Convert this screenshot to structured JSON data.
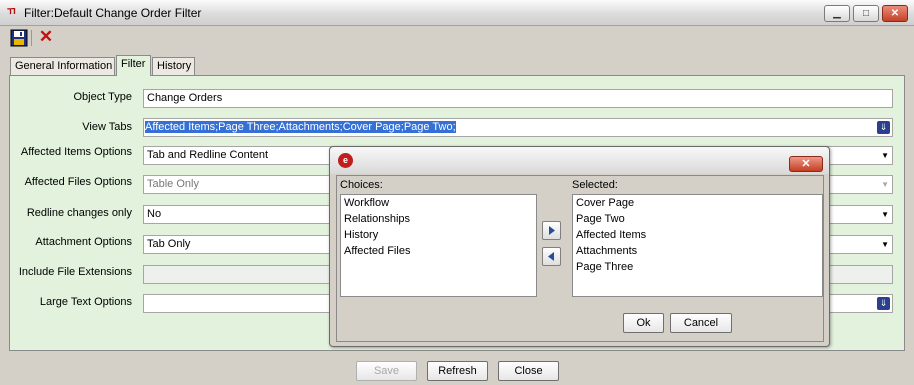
{
  "window": {
    "title": "Filter:Default Change Order Filter",
    "minimize_label": "▁",
    "maximize_label": "□",
    "close_label": "✕"
  },
  "tabs": [
    {
      "label": "General Information"
    },
    {
      "label": "Filter"
    },
    {
      "label": "History"
    }
  ],
  "form": {
    "object_type": {
      "label": "Object Type",
      "value": "Change Orders"
    },
    "view_tabs": {
      "label": "View Tabs",
      "value": "Affected Items;Page Three;Attachments;Cover Page;Page Two;"
    },
    "affected_items_options": {
      "label": "Affected Items Options",
      "value": "Tab and Redline Content"
    },
    "affected_files_options": {
      "label": "Affected Files Options",
      "value": "Table Only"
    },
    "redline_changes_only": {
      "label": "Redline changes only",
      "value": "No"
    },
    "attachment_options": {
      "label": "Attachment Options",
      "value": "Tab Only"
    },
    "include_file_extensions": {
      "label": "Include File Extensions",
      "value": ""
    },
    "large_text_options": {
      "label": "Large Text Options",
      "value": ""
    }
  },
  "buttons": {
    "save": "Save",
    "refresh": "Refresh",
    "close": "Close"
  },
  "dialog": {
    "choices_label": "Choices:",
    "selected_label": "Selected:",
    "choices": [
      "Workflow",
      "Relationships",
      "History",
      "Affected Files"
    ],
    "selected": [
      "Cover Page",
      "Page Two",
      "Affected Items",
      "Attachments",
      "Page Three"
    ],
    "ok_label": "Ok",
    "cancel_label": "Cancel"
  }
}
